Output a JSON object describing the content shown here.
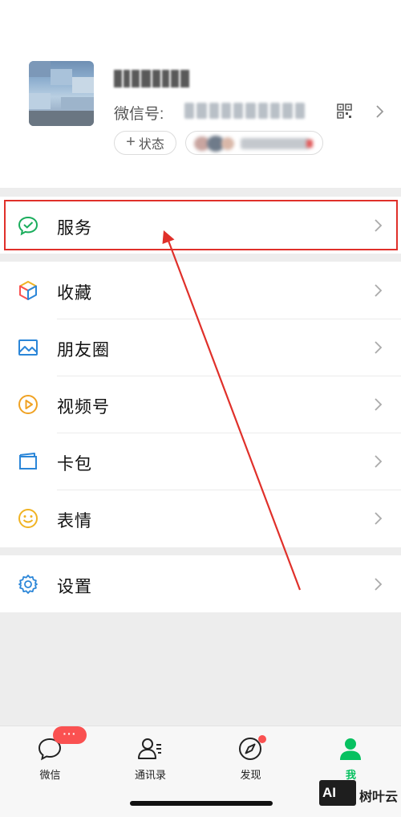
{
  "profile": {
    "wxid_label": "微信号:",
    "status_label": "状态",
    "status_plus": "+"
  },
  "menu": {
    "services": "服务",
    "favorites": "收藏",
    "moments": "朋友圈",
    "channels": "视频号",
    "cards": "卡包",
    "stickers": "表情",
    "settings": "设置"
  },
  "tabbar": {
    "chats": "微信",
    "contacts": "通讯录",
    "discover": "发现",
    "me": "我",
    "chats_badge": "···"
  },
  "watermark": {
    "logo": "AI",
    "text": "树叶云"
  },
  "colors": {
    "accent": "#07c160",
    "badge": "#fa5151",
    "annotation": "#e0302a"
  }
}
